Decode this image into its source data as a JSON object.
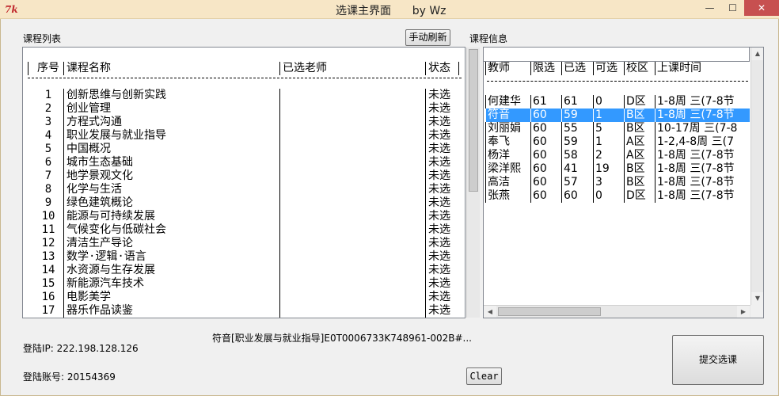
{
  "window": {
    "title": "选课主界面      by Wz",
    "icon_text": "7k",
    "min_glyph": "—",
    "max_glyph": "☐",
    "close_glyph": "✕"
  },
  "labels": {
    "course_list": "课程列表",
    "course_info": "课程信息",
    "login_ip": "登陆IP: 222.198.128.126",
    "login_account": "登陆账号: 20154369"
  },
  "buttons": {
    "refresh": "手动刷新",
    "clear": "Clear",
    "submit": "提交选课"
  },
  "status_line": "符音[职业发展与就业指导]E0T0006733K748961-002B#...",
  "course_list": {
    "headers": {
      "no": "序号",
      "name": "课程名称",
      "teacher": "已选老师",
      "status": "状态"
    },
    "rows": [
      {
        "no": "1",
        "name": "创新思维与创新实践",
        "teacher": "",
        "status": "未选"
      },
      {
        "no": "2",
        "name": "创业管理",
        "teacher": "",
        "status": "未选"
      },
      {
        "no": "3",
        "name": "方程式沟通",
        "teacher": "",
        "status": "未选"
      },
      {
        "no": "4",
        "name": "职业发展与就业指导",
        "teacher": "",
        "status": "未选"
      },
      {
        "no": "5",
        "name": "中国概况",
        "teacher": "",
        "status": "未选"
      },
      {
        "no": "6",
        "name": "城市生态基础",
        "teacher": "",
        "status": "未选"
      },
      {
        "no": "7",
        "name": "地学景观文化",
        "teacher": "",
        "status": "未选"
      },
      {
        "no": "8",
        "name": "化学与生活",
        "teacher": "",
        "status": "未选"
      },
      {
        "no": "9",
        "name": "绿色建筑概论",
        "teacher": "",
        "status": "未选"
      },
      {
        "no": "10",
        "name": "能源与可持续发展",
        "teacher": "",
        "status": "未选"
      },
      {
        "no": "11",
        "name": "气候变化与低碳社会",
        "teacher": "",
        "status": "未选"
      },
      {
        "no": "12",
        "name": "清洁生产导论",
        "teacher": "",
        "status": "未选"
      },
      {
        "no": "13",
        "name": "数学·逻辑·语言",
        "teacher": "",
        "status": "未选"
      },
      {
        "no": "14",
        "name": "水资源与生存发展",
        "teacher": "",
        "status": "未选"
      },
      {
        "no": "15",
        "name": "新能源汽车技术",
        "teacher": "",
        "status": "未选"
      },
      {
        "no": "16",
        "name": "电影美学",
        "teacher": "",
        "status": "未选"
      },
      {
        "no": "17",
        "name": "器乐作品读鉴",
        "teacher": "",
        "status": "未选"
      }
    ]
  },
  "course_info": {
    "headers": {
      "teacher": "教师",
      "limit": "限选",
      "chosen": "已选",
      "available": "可选",
      "campus": "校区",
      "time": "上课时间"
    },
    "rows": [
      {
        "teacher": "何建华",
        "limit": "61",
        "chosen": "61",
        "available": "0",
        "campus": "D区",
        "time": "1-8周 三(7-8节",
        "selected": false
      },
      {
        "teacher": "符音",
        "limit": "60",
        "chosen": "59",
        "available": "1",
        "campus": "B区",
        "time": "1-8周 三(7-8节",
        "selected": true
      },
      {
        "teacher": "刘丽娟",
        "limit": "60",
        "chosen": "55",
        "available": "5",
        "campus": "B区",
        "time": "10-17周 三(7-8",
        "selected": false
      },
      {
        "teacher": "奉飞",
        "limit": "60",
        "chosen": "59",
        "available": "1",
        "campus": "A区",
        "time": "1-2,4-8周 三(7",
        "selected": false
      },
      {
        "teacher": "杨洋",
        "limit": "60",
        "chosen": "58",
        "available": "2",
        "campus": "A区",
        "time": "1-8周 三(7-8节",
        "selected": false
      },
      {
        "teacher": "梁洋熙",
        "limit": "60",
        "chosen": "41",
        "available": "19",
        "campus": "B区",
        "time": "1-8周 三(7-8节",
        "selected": false
      },
      {
        "teacher": "高洁",
        "limit": "60",
        "chosen": "57",
        "available": "3",
        "campus": "B区",
        "time": "1-8周 三(7-8节",
        "selected": false
      },
      {
        "teacher": "张燕",
        "limit": "60",
        "chosen": "60",
        "available": "0",
        "campus": "D区",
        "time": "1-8周 三(7-8节",
        "selected": false
      }
    ]
  },
  "scroll_glyphs": {
    "up": "▲",
    "down": "▼",
    "left": "◀",
    "right": "▶"
  },
  "colors": {
    "selection": "#3399ff",
    "close_button": "#c75050",
    "title_bar": "#f7e6c6"
  }
}
